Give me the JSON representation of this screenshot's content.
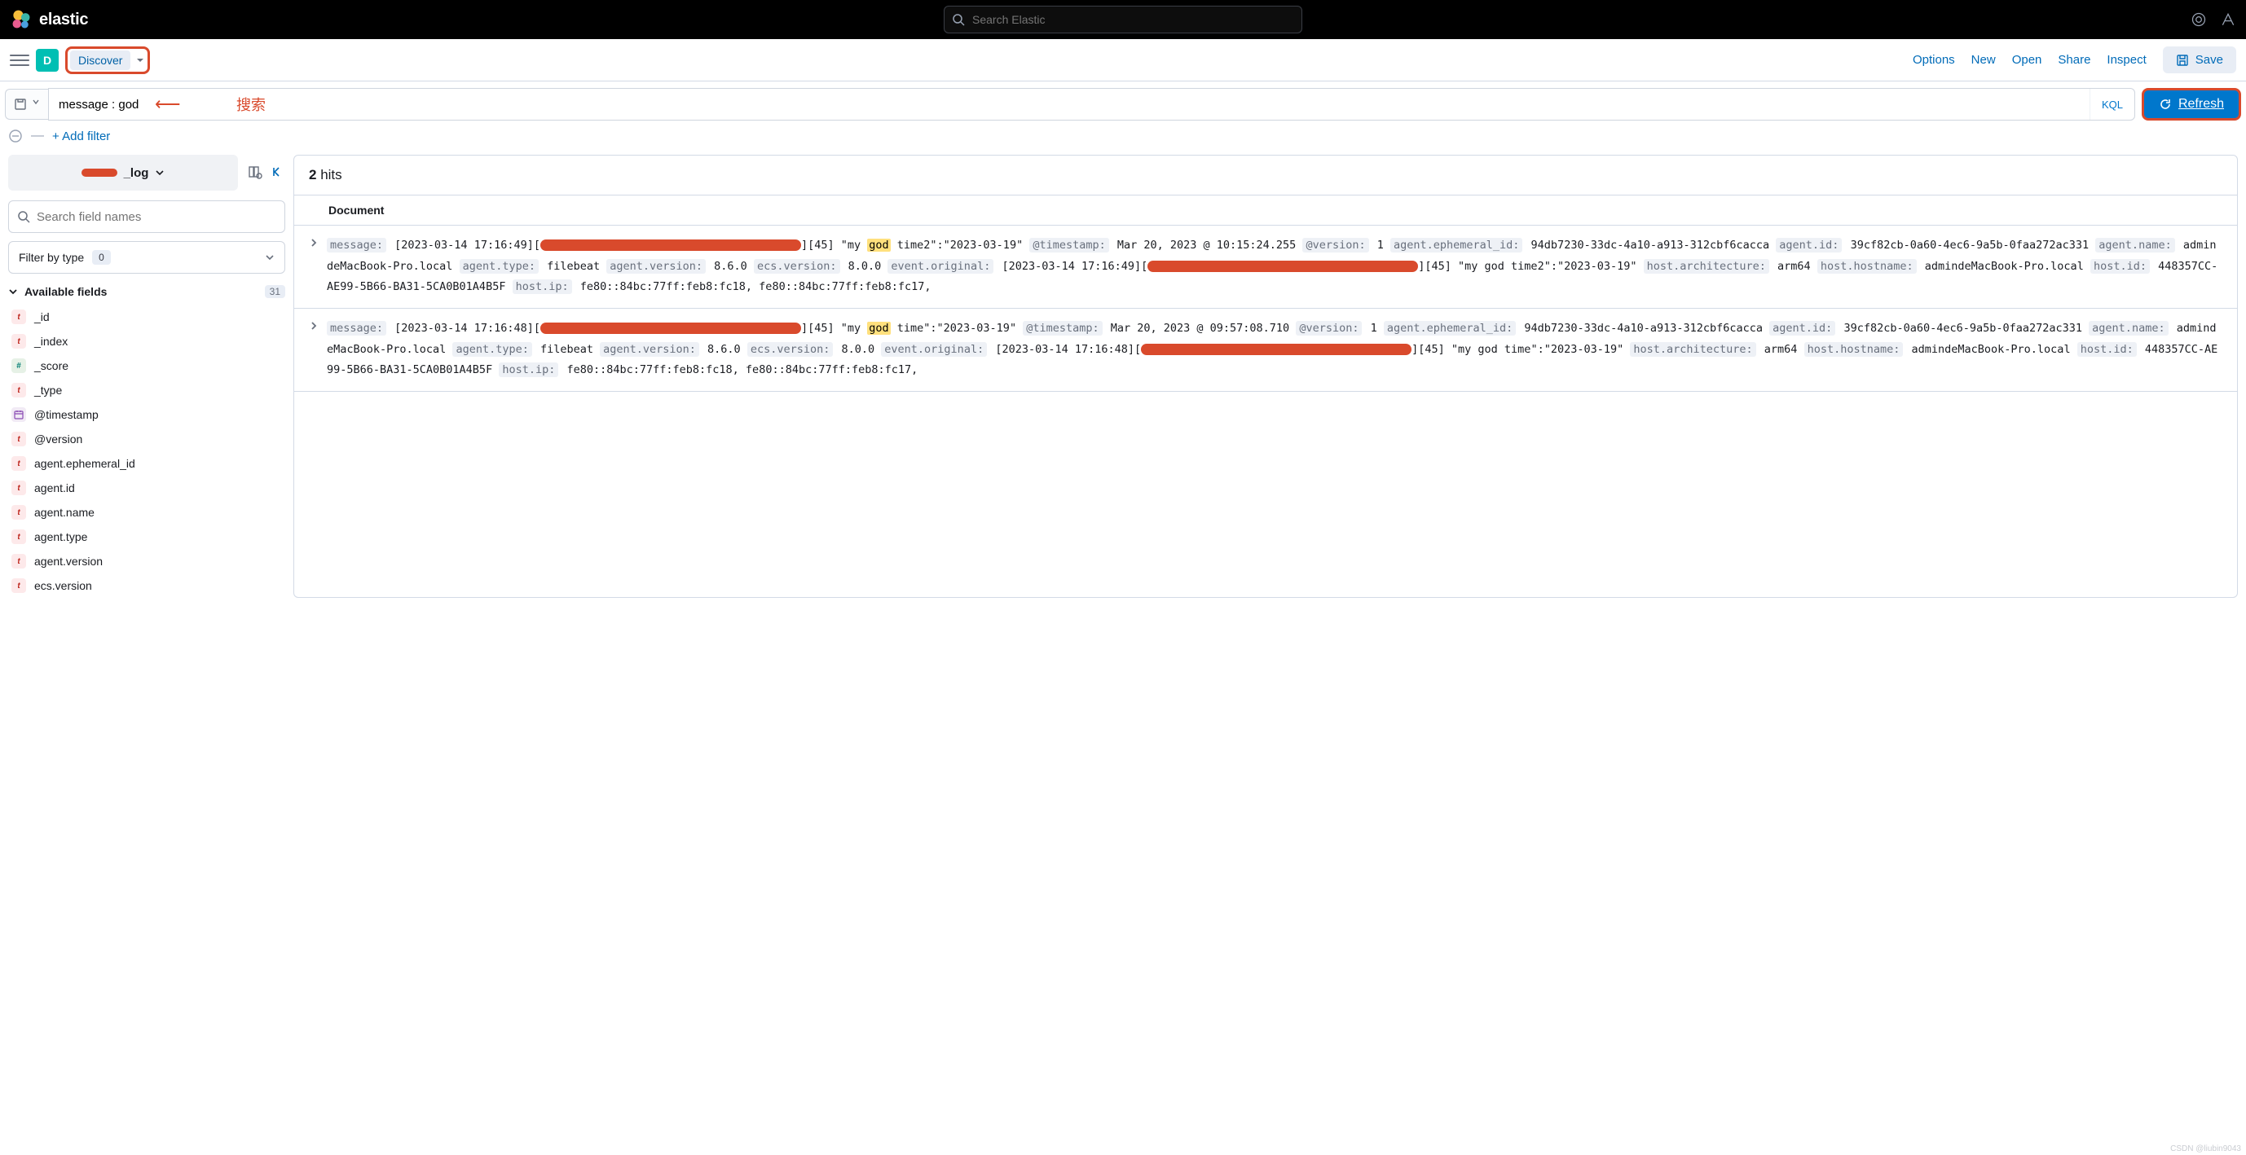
{
  "brand": {
    "name": "elastic"
  },
  "top_search": {
    "placeholder": "Search Elastic"
  },
  "toolbar": {
    "space_letter": "D",
    "discover_label": "Discover",
    "links": {
      "options": "Options",
      "new": "New",
      "open": "Open",
      "share": "Share",
      "inspect": "Inspect"
    },
    "save_label": "Save"
  },
  "query": {
    "value": "message : god",
    "kql_label": "KQL",
    "refresh_label": "Refresh",
    "annotation_text": "搜索"
  },
  "filter_bar": {
    "add_filter_label": "+ Add filter"
  },
  "sidebar": {
    "index_suffix": "_log",
    "field_search_placeholder": "Search field names",
    "filter_by_type_label": "Filter by type",
    "filter_by_type_count": "0",
    "available_fields_label": "Available fields",
    "available_fields_count": "31",
    "fields": [
      {
        "type": "t",
        "name": "_id"
      },
      {
        "type": "t",
        "name": "_index"
      },
      {
        "type": "num",
        "name": "_score"
      },
      {
        "type": "t",
        "name": "_type"
      },
      {
        "type": "date",
        "name": "@timestamp"
      },
      {
        "type": "t",
        "name": "@version"
      },
      {
        "type": "t",
        "name": "agent.ephemeral_id"
      },
      {
        "type": "t",
        "name": "agent.id"
      },
      {
        "type": "t",
        "name": "agent.name"
      },
      {
        "type": "t",
        "name": "agent.type"
      },
      {
        "type": "t",
        "name": "agent.version"
      },
      {
        "type": "t",
        "name": "ecs.version"
      }
    ]
  },
  "results": {
    "hits_count": "2",
    "hits_label": "hits",
    "document_column": "Document",
    "docs": [
      {
        "message_prefix": "[2023-03-14 17:16:49][",
        "message_suffix": "][45] \"my ",
        "highlight": "god",
        "message_after_hl": " time2\":\"2023-03-19\"",
        "timestamp": "Mar 20, 2023 @ 10:15:24.255",
        "version": "1",
        "agent_ephemeral_id": "94db7230-33dc-4a10-a913-312cbf6cacca",
        "agent_id": "39cf82cb-0a60-4ec6-9a5b-0faa272ac331",
        "agent_name": "admindeMacBook-Pro.local",
        "agent_type": "filebeat",
        "agent_version": "8.6.0",
        "ecs_version": "8.0.0",
        "event_original_prefix": "[2023-03-14 17:16:49][",
        "event_original_suffix": "][45] \"my god time2\":\"2023-03-19\"",
        "host_architecture": "arm64",
        "host_hostname": "admindeMacBook-Pro.local",
        "host_id": "448357CC-AE99-5B66-BA31-5CA0B01A4B5F",
        "host_ip": "fe80::84bc:77ff:feb8:fc18, fe80::84bc:77ff:feb8:fc17,"
      },
      {
        "message_prefix": "[2023-03-14 17:16:48][",
        "message_suffix": "][45] \"my ",
        "highlight": "god",
        "message_after_hl": " time\":\"2023-03-19\"",
        "timestamp": "Mar 20, 2023 @ 09:57:08.710",
        "version": "1",
        "agent_ephemeral_id": "94db7230-33dc-4a10-a913-312cbf6cacca",
        "agent_id": "39cf82cb-0a60-4ec6-9a5b-0faa272ac331",
        "agent_name": "admindeMacBook-Pro.local",
        "agent_type": "filebeat",
        "agent_version": "8.6.0",
        "ecs_version": "8.0.0",
        "event_original_prefix": "[2023-03-14 17:16:48][",
        "event_original_suffix": "][45] \"my god time\":\"2023-03-19\"",
        "host_architecture": "arm64",
        "host_hostname": "admindeMacBook-Pro.local",
        "host_id": "448357CC-AE99-5B66-BA31-5CA0B01A4B5F",
        "host_ip": "fe80::84bc:77ff:feb8:fc18, fe80::84bc:77ff:feb8:fc17,"
      }
    ]
  },
  "labels": {
    "message": "message:",
    "timestamp": "@timestamp:",
    "version": "@version:",
    "agent_ephemeral_id": "agent.ephemeral_id:",
    "agent_id": "agent.id:",
    "agent_name": "agent.name:",
    "agent_type": "agent.type:",
    "agent_version": "agent.version:",
    "ecs_version": "ecs.version:",
    "event_original": "event.original:",
    "host_architecture": "host.architecture:",
    "host_hostname": "host.hostname:",
    "host_id": "host.id:",
    "host_ip": "host.ip:"
  },
  "watermark": "CSDN @liubin9043"
}
